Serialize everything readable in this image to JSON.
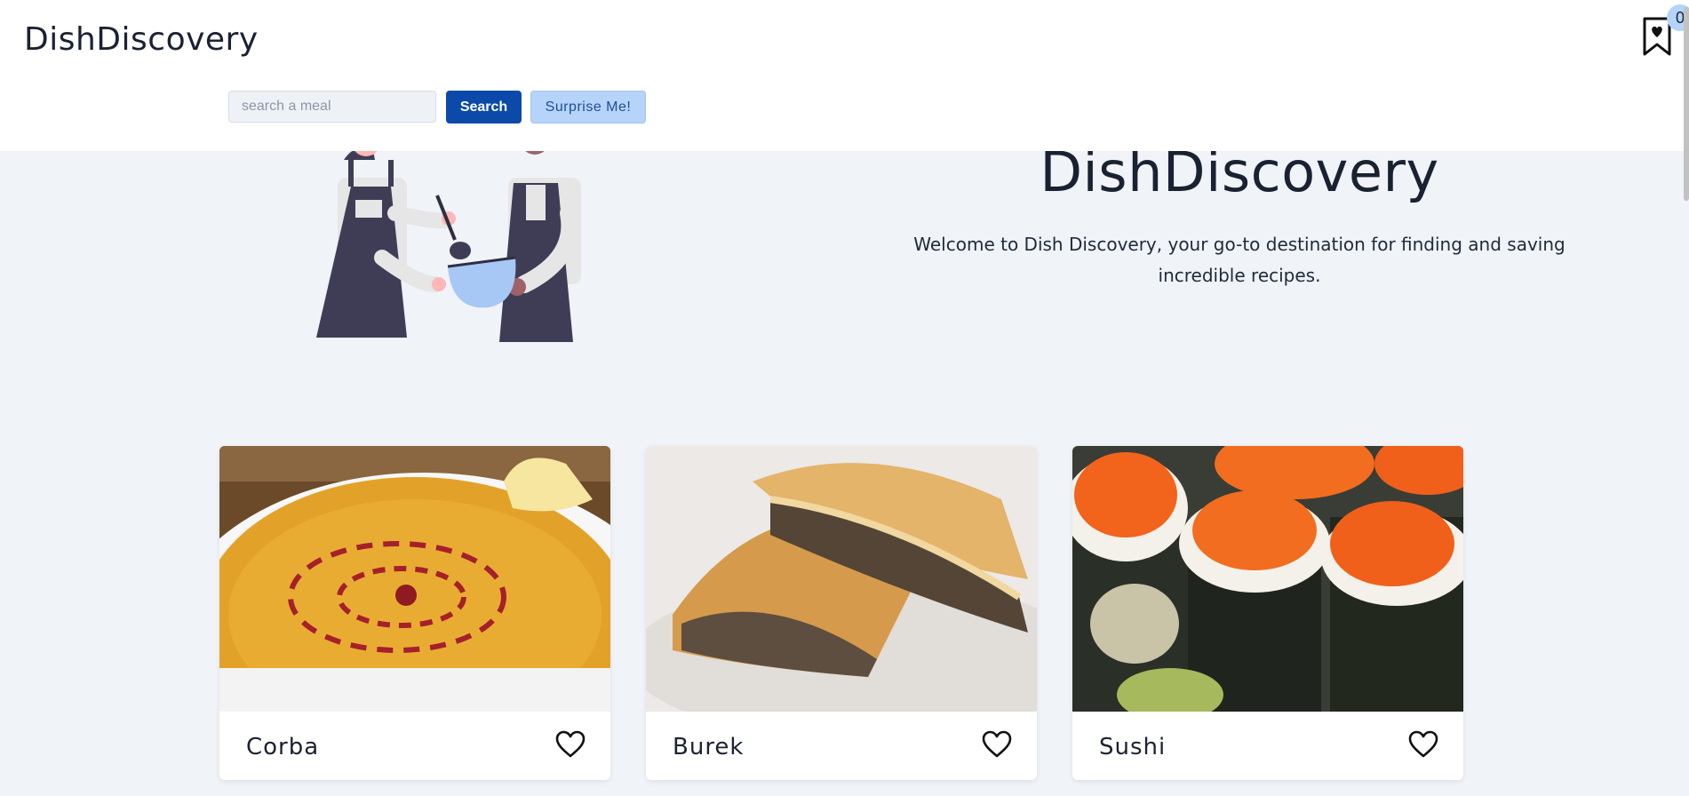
{
  "header": {
    "brand": "DishDiscovery",
    "search": {
      "placeholder": "search a meal",
      "value": ""
    },
    "search_button_label": "Search",
    "surprise_button_label": "Surprise Me!",
    "bookmark": {
      "icon": "bookmark-heart-icon",
      "count": "0"
    }
  },
  "hero": {
    "title": "DishDiscovery",
    "text": "Welcome to Dish Discovery, your go-to destination for finding and saving incredible recipes.",
    "illustration": "two-cooks-mixing-bowl"
  },
  "meals": [
    {
      "name": "Corba",
      "image": "lentil-soup-photo",
      "favorite_icon": "heart-outline-icon"
    },
    {
      "name": "Burek",
      "image": "meat-pastry-photo",
      "favorite_icon": "heart-outline-icon"
    },
    {
      "name": "Sushi",
      "image": "sushi-rolls-roe-photo",
      "favorite_icon": "heart-outline-icon"
    }
  ],
  "colors": {
    "background": "#f0f3f8",
    "primary": "#0b4aa8",
    "light_accent": "#b6d3fa",
    "text": "#1a2232"
  }
}
